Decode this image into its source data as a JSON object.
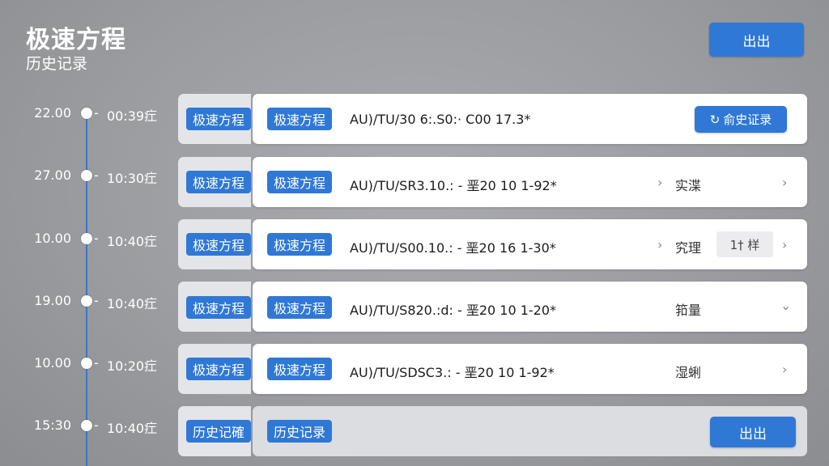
{
  "header": {
    "title": "极速方程",
    "subtitle": "历史记录",
    "exit_label": "出出"
  },
  "timeline": [
    {
      "start": "22.00",
      "dash": "-",
      "end": "00:39疘"
    },
    {
      "start": "27.00",
      "dash": "-",
      "end": "10:30疘"
    },
    {
      "start": "10.00",
      "dash": "-",
      "end": "10:40疘"
    },
    {
      "start": "19.00",
      "dash": "-",
      "end": "10:40疘"
    },
    {
      "start": "10.00",
      "dash": "-",
      "end": "10:20疘"
    },
    {
      "start": "15:30",
      "dash": "-",
      "end": "10:40疘"
    }
  ],
  "rows": [
    {
      "back_tag": "极速方程",
      "front_tag": "极速方程",
      "code": "AU)/TU/30 6:.S0:·  C00 17.3*",
      "button_label": "俞史证录",
      "button_icon": "history-icon"
    },
    {
      "back_tag": "极速方程",
      "front_tag": "极速方程",
      "code": "AU)/TU/SR3.10.: - 垩20 10 1-92*",
      "arrow": "›",
      "status": "实渫",
      "chevron": "›"
    },
    {
      "back_tag": "极速方程",
      "front_tag": "极速方程",
      "code": "AU)/TU/S00.10.: - 垩20 16 1-30*",
      "arrow": "›",
      "status": "究理",
      "chip": "1† 样",
      "chevron": "›"
    },
    {
      "back_tag": "极速方程",
      "front_tag": "极速方程",
      "code": "AU)/TU/S820.:d: - 垩20 10 1-20*",
      "status": "筘量",
      "chevron": "⌄"
    },
    {
      "back_tag": "极速方程",
      "front_tag": "极速方程",
      "code": "AU)/TU/SDSC3.: - 垩20 10 1-92*",
      "status": "湿蜊",
      "chevron": "›"
    }
  ],
  "bottom_row": {
    "back_tag": "历史记確",
    "front_tag": "历史记录",
    "exit_label": "出出"
  },
  "colors": {
    "accent": "#2f78d6",
    "timeline": "#3a76c9",
    "background": "#9a9ca0"
  }
}
